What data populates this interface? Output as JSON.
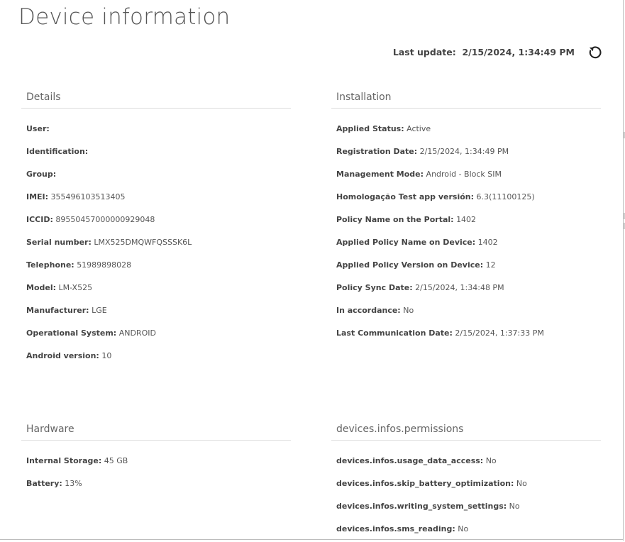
{
  "page": {
    "title": "Device information"
  },
  "header": {
    "last_update_label": "Last update:",
    "last_update_value": "2/15/2024, 1:34:49 PM",
    "refresh_icon": "refresh-icon"
  },
  "sections": {
    "details": {
      "title": "Details",
      "rows": [
        {
          "label": "User:",
          "value": ""
        },
        {
          "label": "Identification:",
          "value": ""
        },
        {
          "label": "Group:",
          "value": ""
        },
        {
          "label": "IMEI:",
          "value": "355496103513405"
        },
        {
          "label": "ICCID:",
          "value": "89550457000000929048"
        },
        {
          "label": "Serial number:",
          "value": "LMX525DMQWFQSSSK6L"
        },
        {
          "label": "Telephone:",
          "value": "51989898028"
        },
        {
          "label": "Model:",
          "value": "LM-X525"
        },
        {
          "label": "Manufacturer:",
          "value": "LGE"
        },
        {
          "label": "Operational System:",
          "value": "ANDROID"
        },
        {
          "label": "Android version:",
          "value": "10"
        }
      ]
    },
    "installation": {
      "title": "Installation",
      "rows": [
        {
          "label": "Applied Status:",
          "value": "Active"
        },
        {
          "label": "Registration Date:",
          "value": "2/15/2024, 1:34:49 PM"
        },
        {
          "label": "Management Mode:",
          "value": "Android - Block SIM"
        },
        {
          "label": "Homologação Test app versión:",
          "value": "6.3(11100125)"
        },
        {
          "label": "Policy Name on the Portal:",
          "value": "1402"
        },
        {
          "label": "Applied Policy Name on Device:",
          "value": "1402"
        },
        {
          "label": "Applied Policy Version on Device:",
          "value": "12"
        },
        {
          "label": "Policy Sync Date:",
          "value": "2/15/2024, 1:34:48 PM"
        },
        {
          "label": "In accordance:",
          "value": "No"
        },
        {
          "label": "Last Communication Date:",
          "value": "2/15/2024, 1:37:33 PM"
        }
      ]
    },
    "hardware": {
      "title": "Hardware",
      "rows": [
        {
          "label": "Internal Storage:",
          "value": "45 GB"
        },
        {
          "label": "Battery:",
          "value": "13%"
        }
      ]
    },
    "permissions": {
      "title": "devices.infos.permissions",
      "rows": [
        {
          "label": "devices.infos.usage_data_access:",
          "value": "No"
        },
        {
          "label": "devices.infos.skip_battery_optimization:",
          "value": "No"
        },
        {
          "label": "devices.infos.writing_system_settings:",
          "value": "No"
        },
        {
          "label": "devices.infos.sms_reading:",
          "value": "No"
        }
      ]
    }
  }
}
